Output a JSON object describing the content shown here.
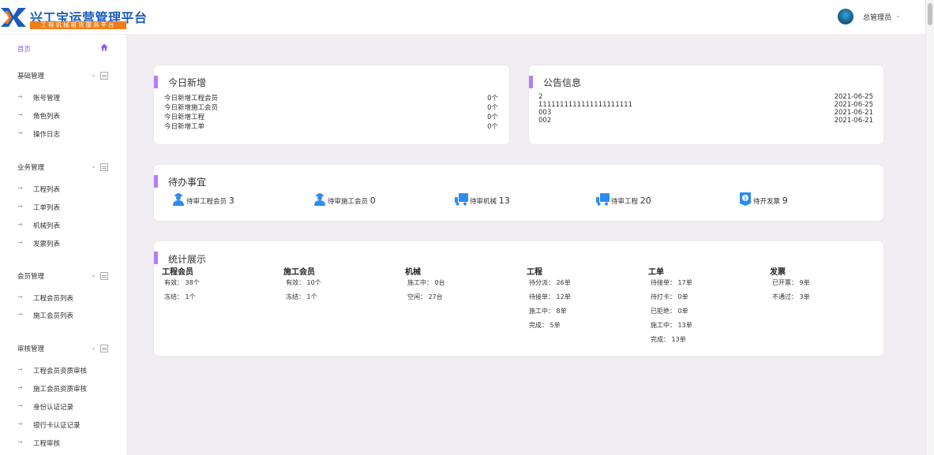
{
  "brand": {
    "title": "兴工宝运营管理平台",
    "subtitle": "工程机械租赁服务平台"
  },
  "user": {
    "name": "总管理员",
    "caret": "⌄"
  },
  "sidebar": {
    "home": "首页",
    "groups": [
      {
        "title": "基础管理",
        "items": [
          "账号管理",
          "角色列表",
          "操作日志"
        ]
      },
      {
        "title": "业务管理",
        "items": [
          "工程列表",
          "工单列表",
          "机械列表",
          "发票列表"
        ]
      },
      {
        "title": "会员管理",
        "items": [
          "工程会员列表",
          "施工会员列表"
        ]
      },
      {
        "title": "审核管理",
        "items": [
          "工程会员资质审核",
          "施工会员资质审核",
          "身份认证记录",
          "银行卡认证记录",
          "工程审核"
        ]
      }
    ],
    "arrow": "→",
    "caret": "⌄"
  },
  "today": {
    "title": "今日新增",
    "rows": [
      {
        "label": "今日新增工程会员",
        "value": "0个"
      },
      {
        "label": "今日新增施工会员",
        "value": "0个"
      },
      {
        "label": "今日新增工程",
        "value": "0个"
      },
      {
        "label": "今日新增工单",
        "value": "0个"
      }
    ]
  },
  "notice": {
    "title": "公告信息",
    "rows": [
      {
        "label": "2",
        "date": "2021-06-25"
      },
      {
        "label": "1111111111111111111111",
        "date": "2021-06-25"
      },
      {
        "label": "003",
        "date": "2021-06-21"
      },
      {
        "label": "002",
        "date": "2021-06-21"
      }
    ]
  },
  "todo": {
    "title": "待办事宜",
    "items": [
      {
        "label": "待审工程会员",
        "count": "3",
        "icon": "engineer-member-icon"
      },
      {
        "label": "待审施工会员",
        "count": "0",
        "icon": "worker-member-icon"
      },
      {
        "label": "待审机械",
        "count": "13",
        "icon": "truck-icon"
      },
      {
        "label": "待审工程",
        "count": "20",
        "icon": "truck-icon"
      },
      {
        "label": "待开发票",
        "count": "9",
        "icon": "invoice-icon"
      }
    ]
  },
  "stats": {
    "title": "统计展示",
    "columns": [
      {
        "head": "工程会员",
        "lines": [
          "有效：  38个",
          "冻结：  1个"
        ]
      },
      {
        "head": "施工会员",
        "lines": [
          "有效：  10个",
          "冻结：  1个"
        ]
      },
      {
        "head": "机械",
        "lines": [
          "施工中：  0台",
          "空闲：  27台"
        ]
      },
      {
        "head": "工程",
        "lines": [
          "待分派：  26单",
          "待接单：  12单",
          "施工中：  8单",
          "完成：  5单"
        ]
      },
      {
        "head": "工单",
        "lines": [
          "待接单：  17单",
          "待打卡：  0单",
          "已拒绝：  0单",
          "施工中：  13单",
          "完成：  13单"
        ]
      },
      {
        "head": "发票",
        "lines": [
          "已开票：  9单",
          "不通过：  3单"
        ]
      }
    ]
  },
  "colors": {
    "accent": "#b57ef5",
    "brand": "#1a5bbf",
    "brand_sub_bg": "#f07d1a",
    "icon_blue": "#2d8cf0"
  }
}
